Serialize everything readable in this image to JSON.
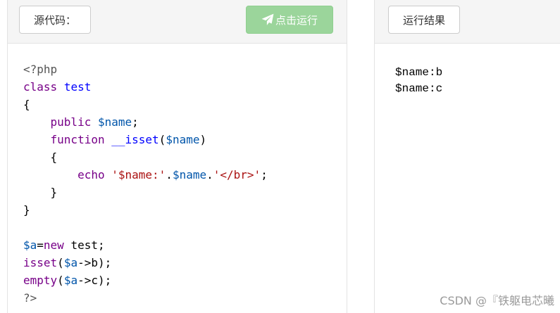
{
  "left_panel": {
    "source_label": "源代码：",
    "run_button_label": "点击运行",
    "run_icon": "paper-plane-icon",
    "code_lines": [
      [
        {
          "t": "<?php",
          "c": "meta"
        }
      ],
      [
        {
          "t": "class",
          "c": "kw"
        },
        {
          "t": " ",
          "c": ""
        },
        {
          "t": "test",
          "c": "def"
        }
      ],
      [
        {
          "t": "{",
          "c": ""
        }
      ],
      [
        {
          "t": "    ",
          "c": ""
        },
        {
          "t": "public",
          "c": "kw"
        },
        {
          "t": " ",
          "c": ""
        },
        {
          "t": "$name",
          "c": "var"
        },
        {
          "t": ";",
          "c": ""
        }
      ],
      [
        {
          "t": "    ",
          "c": ""
        },
        {
          "t": "function",
          "c": "kw"
        },
        {
          "t": " ",
          "c": ""
        },
        {
          "t": "__isset",
          "c": "def"
        },
        {
          "t": "(",
          "c": ""
        },
        {
          "t": "$name",
          "c": "var"
        },
        {
          "t": ")",
          "c": ""
        }
      ],
      [
        {
          "t": "    {",
          "c": ""
        }
      ],
      [
        {
          "t": "        ",
          "c": ""
        },
        {
          "t": "echo",
          "c": "kw"
        },
        {
          "t": " ",
          "c": ""
        },
        {
          "t": "'$name:'",
          "c": "str"
        },
        {
          "t": ".",
          "c": ""
        },
        {
          "t": "$name",
          "c": "var"
        },
        {
          "t": ".",
          "c": ""
        },
        {
          "t": "'</br>'",
          "c": "str"
        },
        {
          "t": ";",
          "c": ""
        }
      ],
      [
        {
          "t": "    }",
          "c": ""
        }
      ],
      [
        {
          "t": "}",
          "c": ""
        }
      ],
      [
        {
          "t": "",
          "c": ""
        }
      ],
      [
        {
          "t": "$a",
          "c": "var"
        },
        {
          "t": "=",
          "c": ""
        },
        {
          "t": "new",
          "c": "kw"
        },
        {
          "t": " test;",
          "c": ""
        }
      ],
      [
        {
          "t": "isset",
          "c": "kw"
        },
        {
          "t": "(",
          "c": ""
        },
        {
          "t": "$a",
          "c": "var"
        },
        {
          "t": "->b);",
          "c": ""
        }
      ],
      [
        {
          "t": "empty",
          "c": "kw"
        },
        {
          "t": "(",
          "c": ""
        },
        {
          "t": "$a",
          "c": "var"
        },
        {
          "t": "->c);",
          "c": ""
        }
      ],
      [
        {
          "t": "?>",
          "c": "meta"
        }
      ]
    ]
  },
  "right_panel": {
    "result_label": "运行结果",
    "output_lines": [
      "$name:b",
      "$name:c"
    ]
  },
  "watermark": "CSDN @『铁躯电芯曦",
  "colors": {
    "run_button": "#9bd59b",
    "keyword": "#770088",
    "variable": "#0055aa",
    "string": "#aa1111",
    "definition": "#0000ff"
  }
}
